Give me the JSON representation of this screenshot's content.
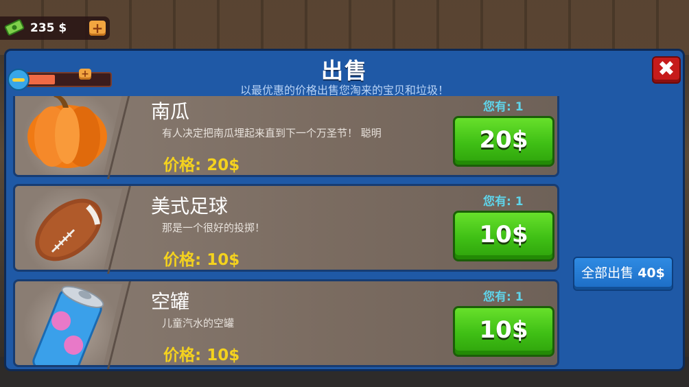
{
  "hud": {
    "money": "235 $",
    "money_plus": "+",
    "energy_plus": "+",
    "energy_level": 0.34
  },
  "panel": {
    "title": "出售",
    "subtitle": "以最优惠的价格出售您淘来的宝贝和垃圾！",
    "close": "✖"
  },
  "items": [
    {
      "name": "南瓜",
      "description": "有人决定把南瓜埋起来直到下一个万圣节！ 聪明",
      "price_label": "价格:",
      "price": "20$",
      "owned_label": "您有:",
      "owned": "1",
      "sell": "20$"
    },
    {
      "name": "美式足球",
      "description": "那是一个很好的投掷！",
      "price_label": "价格:",
      "price": "10$",
      "owned_label": "您有:",
      "owned": "1",
      "sell": "10$"
    },
    {
      "name": "空罐",
      "description": "儿童汽水的空罐",
      "price_label": "价格:",
      "price": "10$",
      "owned_label": "您有:",
      "owned": "1",
      "sell": "10$"
    }
  ],
  "sell_all": {
    "label": "全部出售",
    "total": "40$"
  },
  "colors": {
    "panel": "#1f59a6",
    "sell_button": "#3fbf15",
    "price": "#f4d21e",
    "owned": "#5fd4ea",
    "close": "#c61b1b"
  }
}
